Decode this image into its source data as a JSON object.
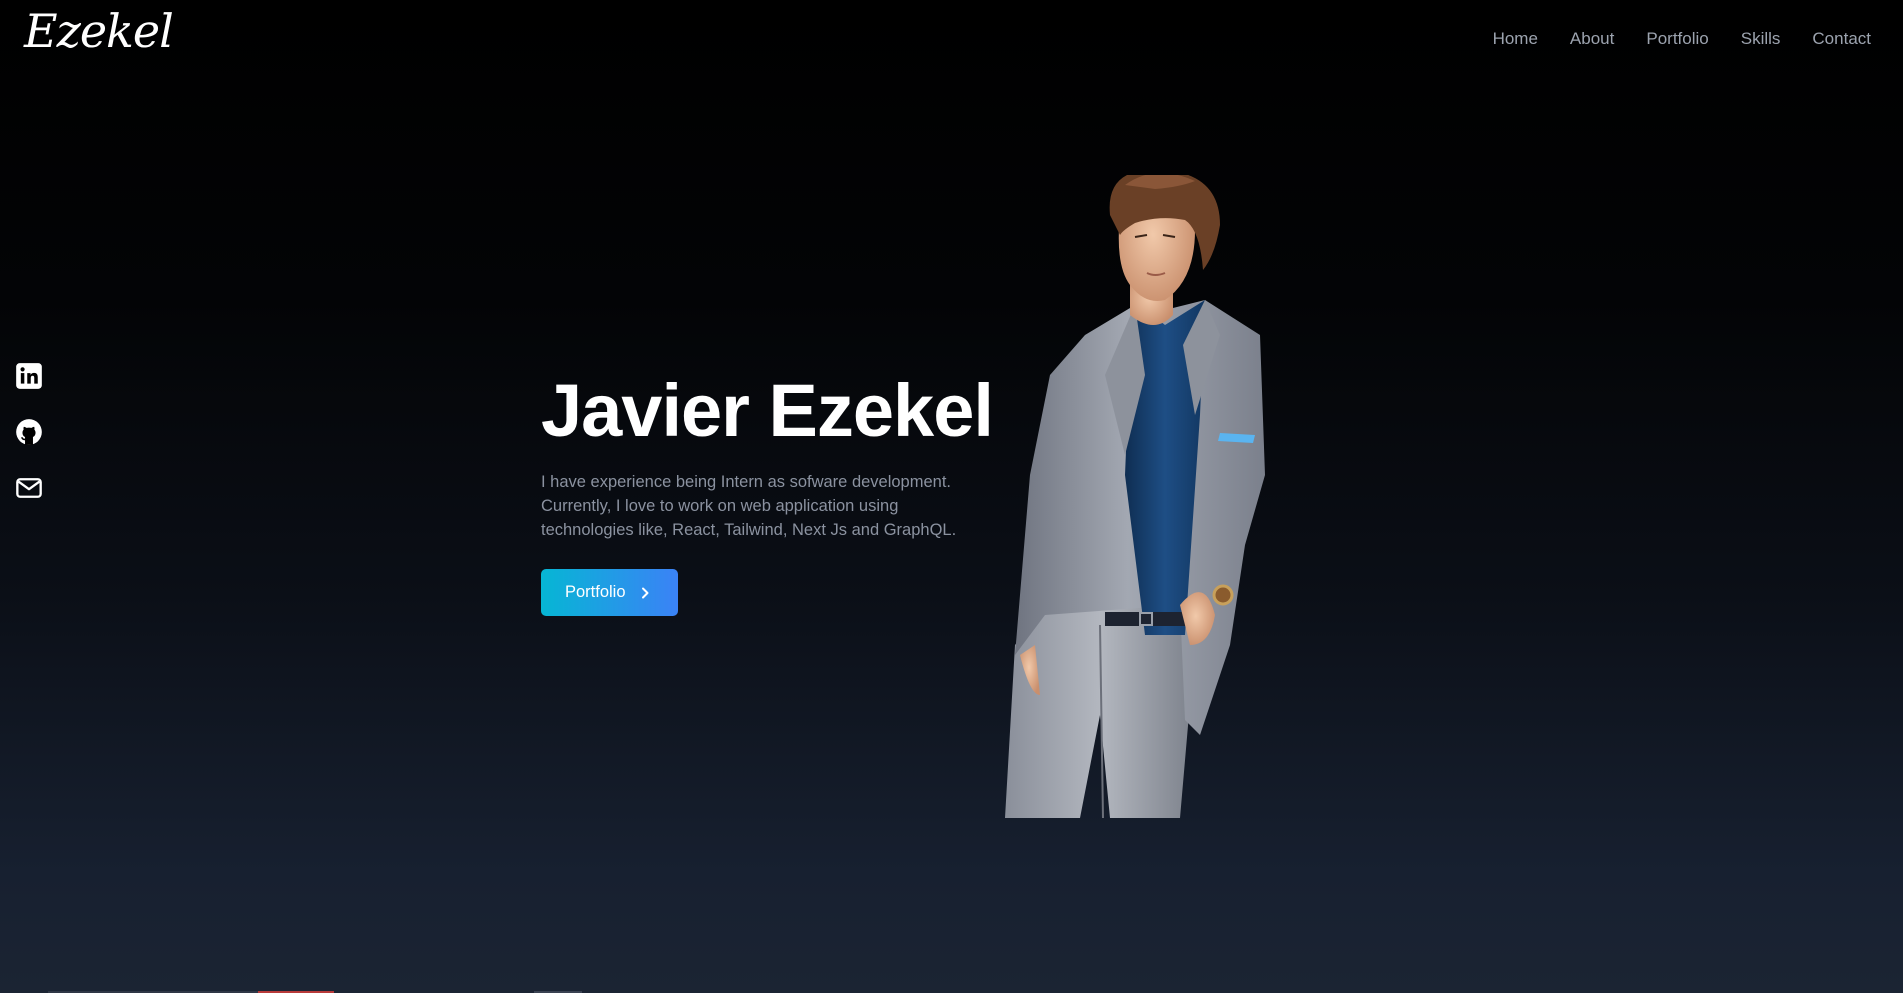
{
  "brand": {
    "logo": "Ezekel"
  },
  "nav": {
    "items": [
      {
        "label": "Home"
      },
      {
        "label": "About"
      },
      {
        "label": "Portfolio"
      },
      {
        "label": "Skills"
      },
      {
        "label": "Contact"
      }
    ]
  },
  "social": {
    "icons": [
      "linkedin-icon",
      "github-icon",
      "mail-icon"
    ]
  },
  "hero": {
    "name": "Javier Ezekel",
    "description": "I have experience being Intern as sofware development. Currently, I love to work on web application using technologies like, React, Tailwind, Next Js and GraphQL.",
    "button_label": "Portfolio",
    "button_icon": "chevron-right-icon"
  },
  "colors": {
    "accent_start": "#06b6d4",
    "accent_end": "#3b82f6",
    "nav_text": "#9ca3af",
    "body_text": "#8b92a0"
  }
}
